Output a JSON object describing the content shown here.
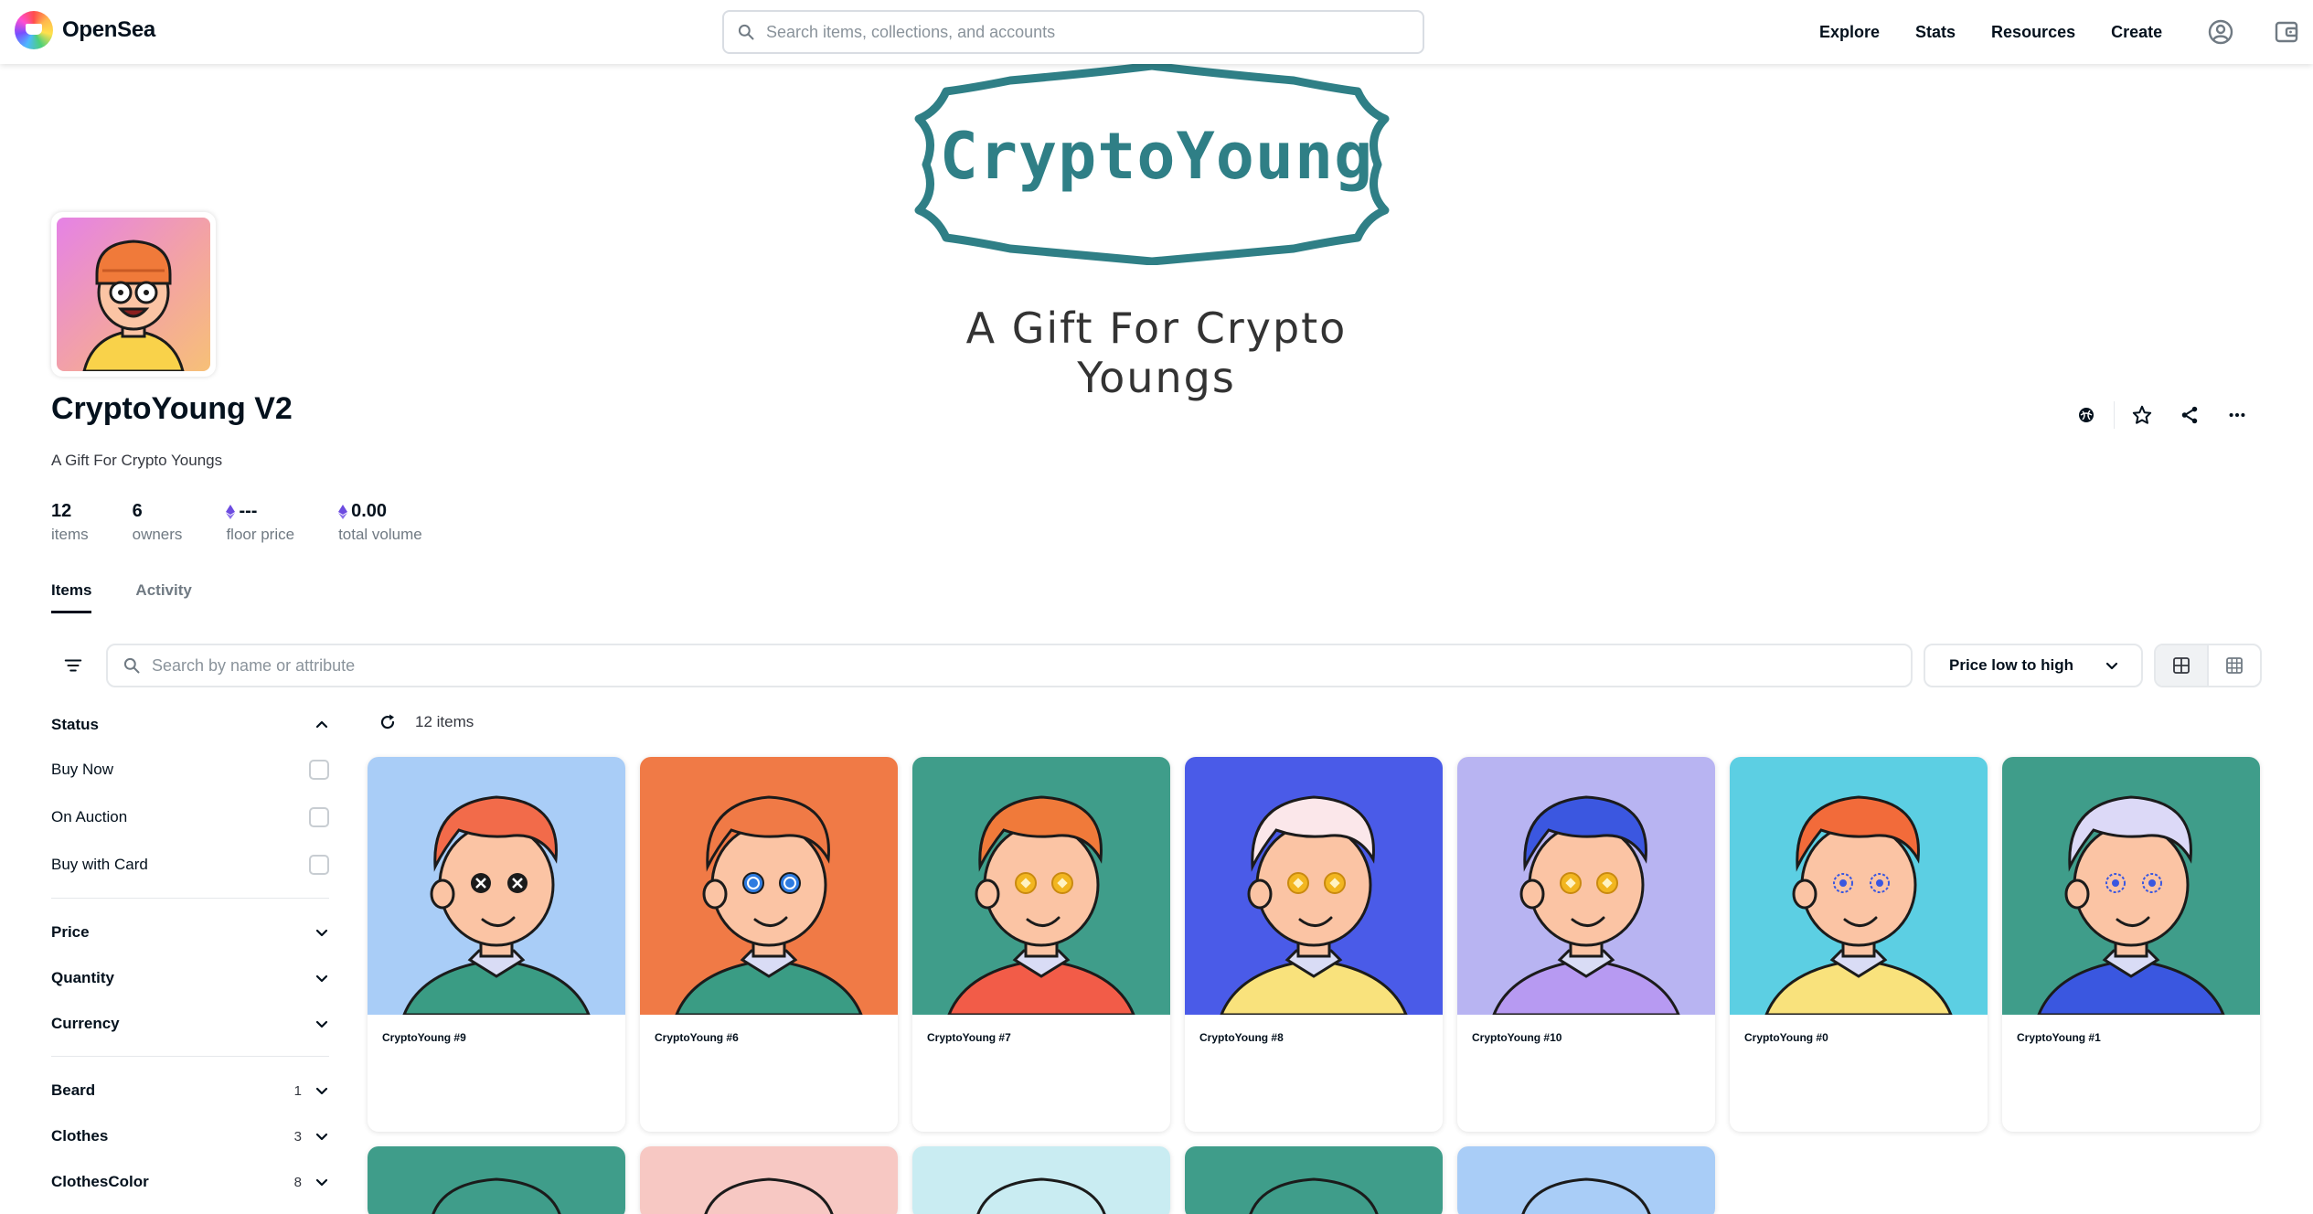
{
  "nav": {
    "brand": "OpenSea",
    "search_placeholder": "Search items, collections, and accounts",
    "links": [
      "Explore",
      "Stats",
      "Resources",
      "Create"
    ]
  },
  "banner": {
    "title": "CryptoYoung",
    "subtitle": "A Gift For Crypto Youngs"
  },
  "collection": {
    "name": "CryptoYoung V2",
    "description": "A Gift For Crypto Youngs",
    "stats": [
      {
        "value": "12",
        "label": "items",
        "eth": false
      },
      {
        "value": "6",
        "label": "owners",
        "eth": false
      },
      {
        "value": "---",
        "label": "floor price",
        "eth": true
      },
      {
        "value": "0.00",
        "label": "total volume",
        "eth": true
      }
    ]
  },
  "tabs": [
    "Items",
    "Activity"
  ],
  "filters": {
    "search_placeholder": "Search by name or attribute",
    "sort_label": "Price low to high",
    "status_header": "Status",
    "status_options": [
      "Buy Now",
      "On Auction",
      "Buy with Card"
    ],
    "sections": [
      "Price",
      "Quantity",
      "Currency"
    ],
    "traits": [
      {
        "name": "Beard",
        "count": "1"
      },
      {
        "name": "Clothes",
        "count": "3"
      },
      {
        "name": "ClothesColor",
        "count": "8"
      }
    ]
  },
  "results": {
    "count_label": "12 items"
  },
  "items": [
    {
      "name": "CryptoYoung #9",
      "bg": "#a9cdf7",
      "hair": "#f26b4a",
      "shirt": "#3a9c84",
      "eyes": "x"
    },
    {
      "name": "CryptoYoung #6",
      "bg": "#f07a46",
      "hair": "#f07a46",
      "shirt": "#3a9c84",
      "eyes": "dollar"
    },
    {
      "name": "CryptoYoung #7",
      "bg": "#3f9d8a",
      "hair": "#f07a3a",
      "shirt": "#f25c48",
      "eyes": "coin"
    },
    {
      "name": "CryptoYoung #8",
      "bg": "#4a5be8",
      "hair": "#fbe7ea",
      "shirt": "#f9e27c",
      "eyes": "coin"
    },
    {
      "name": "CryptoYoung #10",
      "bg": "#b8b4f2",
      "hair": "#3b57e0",
      "shirt": "#b79af2",
      "eyes": "coin"
    },
    {
      "name": "CryptoYoung #0",
      "bg": "#5ccfe3",
      "hair": "#f26b3a",
      "shirt": "#f9e27c",
      "eyes": "star"
    },
    {
      "name": "CryptoYoung #1",
      "bg": "#3f9d8a",
      "hair": "#dcd9f7",
      "shirt": "#3a57e0",
      "eyes": "star"
    }
  ],
  "items_row2_bgs": [
    "#3f9d8a",
    "#f7c8c3",
    "#c9ecf2",
    "#3f9d8a",
    "#a9cdf7"
  ],
  "colors": {
    "eth": "#6c4be0",
    "text": "#04111d",
    "muted": "#707a83"
  }
}
